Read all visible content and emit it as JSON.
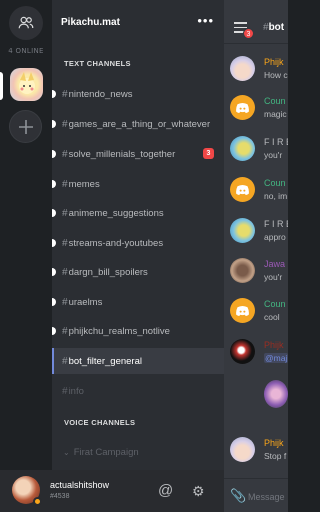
{
  "rail": {
    "online_text": "4 ONLINE",
    "dm_icon": "people-icon",
    "add_icon": "plus-icon"
  },
  "guild": {
    "name": "Pikachu.mat",
    "more_icon": "more-icon"
  },
  "categories": {
    "text": "TEXT CHANNELS",
    "voice": "VOICE CHANNELS"
  },
  "channels": [
    {
      "name": "nintendo_news",
      "unread": true,
      "badge": null
    },
    {
      "name": "games_are_a_thing_or_whatever",
      "unread": true,
      "badge": null
    },
    {
      "name": "solve_millenials_together",
      "unread": true,
      "badge": "3"
    },
    {
      "name": "memes",
      "unread": true,
      "badge": null
    },
    {
      "name": "animeme_suggestions",
      "unread": true,
      "badge": null
    },
    {
      "name": "streams-and-youtubes",
      "unread": true,
      "badge": null
    },
    {
      "name": "dargn_bill_spoilers",
      "unread": true,
      "badge": null
    },
    {
      "name": "uraelms",
      "unread": true,
      "badge": null
    },
    {
      "name": "phijkchu_realms_notlive",
      "unread": true,
      "badge": null
    },
    {
      "name": "bot_filter_general",
      "unread": false,
      "selected": true,
      "badge": null
    },
    {
      "name": "info",
      "unread": false,
      "muted": true,
      "badge": null
    }
  ],
  "voice_channels": [
    {
      "name": "Firat Campaign"
    }
  ],
  "user": {
    "name": "actualshitshow",
    "tag": "#4538",
    "status_color": "#faa61a"
  },
  "chat": {
    "title_hash": "#",
    "title": "bot",
    "notif_badge": "3",
    "composer_placeholder": "Message",
    "messages": [
      {
        "author": "Phijk",
        "author_color": "#faa61a",
        "text": "How c",
        "avatar": "anime"
      },
      {
        "author": "Coun",
        "author_color": "#43b581",
        "text": "magic",
        "avatar": "discord"
      },
      {
        "author": "F I R E",
        "author_color": "#b9bbbe",
        "text": "you'r",
        "avatar": "blue"
      },
      {
        "author": "Coun",
        "author_color": "#43b581",
        "text": "no, im",
        "avatar": "discord"
      },
      {
        "author": "F I R E",
        "author_color": "#b9bbbe",
        "text": "appro",
        "avatar": "blue"
      },
      {
        "author": "Jawa",
        "author_color": "#9b59b6",
        "text": "you'r",
        "avatar": "brown"
      },
      {
        "author": "Coun",
        "author_color": "#43b581",
        "text": "cool",
        "avatar": "discord"
      },
      {
        "author": "Phijk",
        "author_color": "#992d22",
        "text": "@maj",
        "avatar": "dark",
        "mention": true
      },
      {
        "author": "Phijk",
        "author_color": "#faa61a",
        "text": "Stop f",
        "avatar": "anime"
      }
    ]
  },
  "colors": {
    "accent": "#7289da",
    "danger": "#f04747",
    "sidebar_bg": "#2b2e33",
    "chat_bg": "#36393f"
  }
}
